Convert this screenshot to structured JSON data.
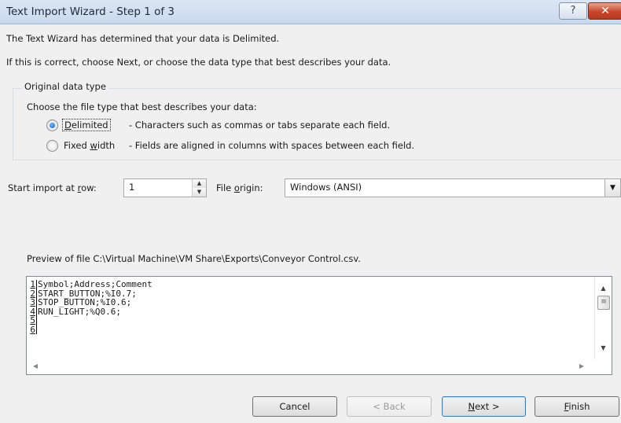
{
  "window": {
    "title": "Text Import Wizard - Step 1 of 3",
    "help_label": "?",
    "close_label": "✕"
  },
  "intro": {
    "line1": "The Text Wizard has determined that your data is Delimited.",
    "line2": "If this is correct, choose Next, or choose the data type that best describes your data."
  },
  "data_type": {
    "legend": "Original data type",
    "prompt": "Choose the file type that best describes your data:",
    "options": [
      {
        "label_pre": "",
        "label_ul": "D",
        "label_post": "elimited",
        "description": "- Characters such as commas or tabs separate each field.",
        "selected": true
      },
      {
        "label_pre": "Fixed ",
        "label_ul": "w",
        "label_post": "idth",
        "description": "- Fields are aligned in columns with spaces between each field.",
        "selected": false
      }
    ]
  },
  "start_row": {
    "label_pre": "Start import at ",
    "label_ul": "r",
    "label_post": "ow:",
    "value": "1"
  },
  "file_origin": {
    "label_pre": "File ",
    "label_ul": "o",
    "label_post": "rigin:",
    "value": "Windows (ANSI)"
  },
  "preview": {
    "label": "Preview of file C:\\Virtual Machine\\VM Share\\Exports\\Conveyor Control.csv.",
    "lines": [
      {
        "num": "1",
        "text": "Symbol;Address;Comment"
      },
      {
        "num": "2",
        "text": "START_BUTTON;%I0.7;"
      },
      {
        "num": "3",
        "text": "STOP_BUTTON;%I0.6;"
      },
      {
        "num": "4",
        "text": "RUN_LIGHT;%Q0.6;"
      },
      {
        "num": "5",
        "text": ""
      },
      {
        "num": "6",
        "text": ""
      }
    ]
  },
  "buttons": {
    "cancel": "Cancel",
    "back": "< Back",
    "next_ul": "N",
    "next_post": "ext >",
    "finish_ul": "F",
    "finish_post": "inish"
  }
}
